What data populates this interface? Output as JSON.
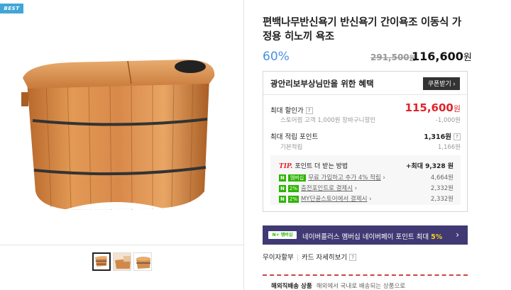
{
  "badge": "BEST",
  "product": {
    "title": "편백나무반신욕기 반신욕기 간이욕조 이동식 가정용 히노끼 욕조",
    "discount": "60%",
    "original_price": "291,500",
    "original_unit": "원",
    "price": "116,600",
    "price_unit": "원"
  },
  "benefit": {
    "title": "광안리보부상님만을 위한 혜택",
    "coupon_button": "쿠폰받기",
    "max_discount_label": "최대 할인가",
    "max_discount_value": "115,600",
    "max_discount_unit": "원",
    "store_coupon_label": "스토어찜 고객 1,000원 장바구니할인",
    "store_coupon_value": "-1,000원",
    "max_points_label": "최대 적립 포인트",
    "max_points_value": "1,316원",
    "basic_points_label": "기본적립",
    "basic_points_value": "1,166원",
    "tip": {
      "prefix": "TIP.",
      "title": "포인트 더 받는 방법",
      "max": "+최대 9,328 원",
      "rows": [
        {
          "badge": "멤버십",
          "text": "무료 가입하고 추가 4% 적립",
          "value": "4,664원"
        },
        {
          "badge": "2%",
          "text": "충전포인트로 결제시",
          "value": "2,332원"
        },
        {
          "badge": "2%",
          "text": "MY단골스토어에서 결제시",
          "value": "2,332원"
        }
      ]
    }
  },
  "npay": {
    "logo": "N+ 멤버십",
    "text": "네이버플러스 멤버십 네이버페이 포인트 최대",
    "highlight": "5%"
  },
  "installment": {
    "label1": "무이자할부",
    "label2": "카드 자세히보기"
  },
  "overseas": {
    "label": "해외직배송 상품",
    "text": "해외에서 국내로 배송되는 상품으로"
  },
  "colors": {
    "accent_blue": "#4a90e2",
    "price_red": "#e0242b",
    "npay_bg": "#3f3a73",
    "naver_green": "#2db400"
  }
}
